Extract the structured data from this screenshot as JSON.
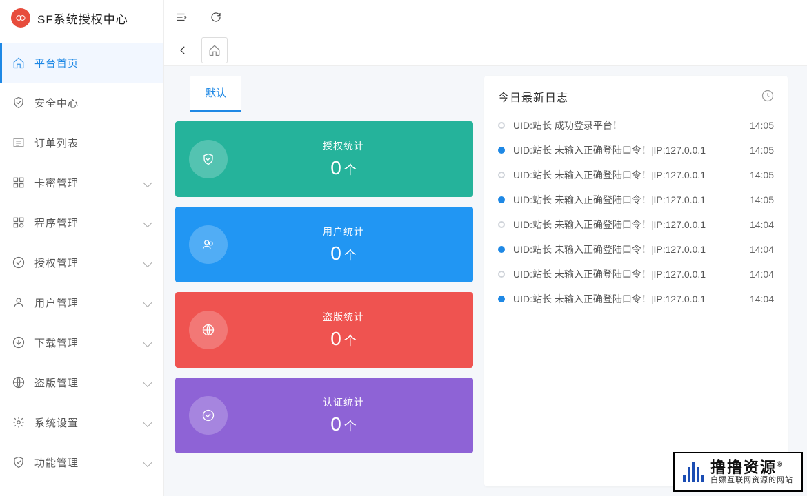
{
  "app": {
    "title": "SF系统授权中心",
    "accent": "#1e88e5"
  },
  "sidebar": {
    "items": [
      {
        "icon": "home",
        "label": "平台首页",
        "active": true,
        "expandable": false
      },
      {
        "icon": "shield",
        "label": "安全中心",
        "active": false,
        "expandable": false
      },
      {
        "icon": "list",
        "label": "订单列表",
        "active": false,
        "expandable": false
      },
      {
        "icon": "grid",
        "label": "卡密管理",
        "active": false,
        "expandable": true
      },
      {
        "icon": "blocks",
        "label": "程序管理",
        "active": false,
        "expandable": true
      },
      {
        "icon": "check",
        "label": "授权管理",
        "active": false,
        "expandable": true
      },
      {
        "icon": "user",
        "label": "用户管理",
        "active": false,
        "expandable": true
      },
      {
        "icon": "download",
        "label": "下载管理",
        "active": false,
        "expandable": true
      },
      {
        "icon": "globe",
        "label": "盗版管理",
        "active": false,
        "expandable": true
      },
      {
        "icon": "gear",
        "label": "系统设置",
        "active": false,
        "expandable": true
      },
      {
        "icon": "shield2",
        "label": "功能管理",
        "active": false,
        "expandable": true
      }
    ]
  },
  "tabs": {
    "default": "默认"
  },
  "stats": {
    "unit": "个",
    "cards": [
      {
        "title": "授权统计",
        "value": "0",
        "color": "green",
        "icon": "shield"
      },
      {
        "title": "用户统计",
        "value": "0",
        "color": "blue",
        "icon": "users"
      },
      {
        "title": "盗版统计",
        "value": "0",
        "color": "red",
        "icon": "globe"
      },
      {
        "title": "认证统计",
        "value": "0",
        "color": "purple",
        "icon": "check"
      }
    ]
  },
  "logs": {
    "title": "今日最新日志",
    "items": [
      {
        "text": "UID:站长 成功登录平台！",
        "time": "14:05",
        "solid": false
      },
      {
        "text": "UID:站长 未输入正确登陆口令！|IP:127.0.0.1",
        "time": "14:05",
        "solid": true
      },
      {
        "text": "UID:站长 未输入正确登陆口令！|IP:127.0.0.1",
        "time": "14:05",
        "solid": false
      },
      {
        "text": "UID:站长 未输入正确登陆口令！|IP:127.0.0.1",
        "time": "14:05",
        "solid": true
      },
      {
        "text": "UID:站长 未输入正确登陆口令！|IP:127.0.0.1",
        "time": "14:04",
        "solid": false
      },
      {
        "text": "UID:站长 未输入正确登陆口令！|IP:127.0.0.1",
        "time": "14:04",
        "solid": true
      },
      {
        "text": "UID:站长 未输入正确登陆口令！|IP:127.0.0.1",
        "time": "14:04",
        "solid": false
      },
      {
        "text": "UID:站长 未输入正确登陆口令！|IP:127.0.0.1",
        "time": "14:04",
        "solid": true
      }
    ]
  },
  "watermark": {
    "big": "撸撸资源",
    "reg": "®",
    "small": "白嫖互联网资源的网站"
  }
}
